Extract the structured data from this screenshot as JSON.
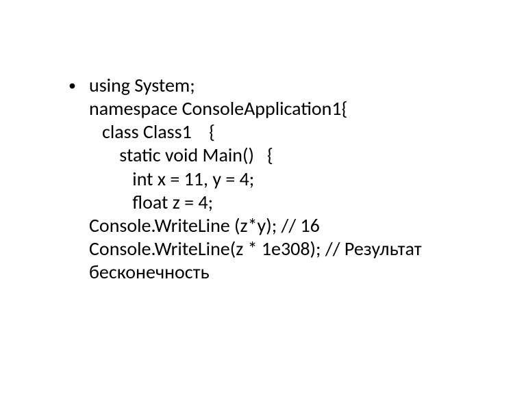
{
  "bullet_glyph": "•",
  "code": {
    "l1": "using System;",
    "l2": "namespace ConsoleApplication1{",
    "l3": "   class Class1    {",
    "l4": "       static void Main()   {",
    "l5": "          int x = 11, y = 4;",
    "l6": "          float z = 4;",
    "l7": "Console.WriteLine (z*y); // 16",
    "l8": "Console.WriteLine(z * 1e308); // Результат бесконечность"
  }
}
